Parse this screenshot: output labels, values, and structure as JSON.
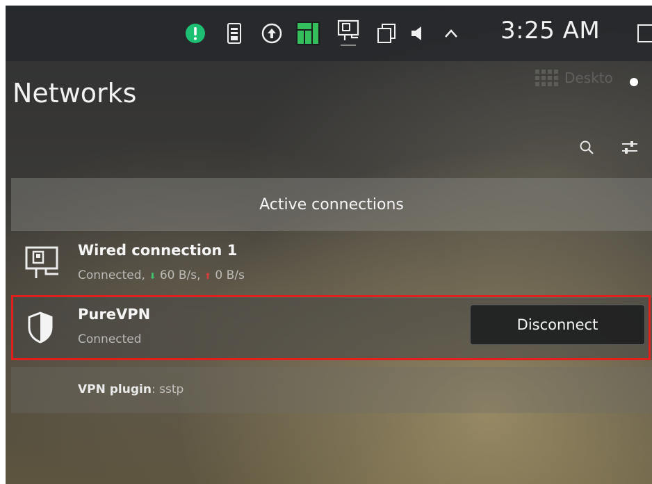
{
  "tray": {
    "clock": "3:25 AM",
    "icons": [
      "update-alert-icon",
      "usb-drive-icon",
      "upload-icon",
      "manjaro-icon",
      "network-icon",
      "clipboard-icon",
      "volume-icon",
      "expand-tray-icon",
      "notification-icon"
    ]
  },
  "colors": {
    "alert_green": "#1dbf73",
    "manjaro_green": "#35bf5c",
    "highlight_red": "#e0201c"
  },
  "header": {
    "title": "Networks",
    "ghost_text": "Deskto"
  },
  "toolbar": {
    "search_icon": "search-icon",
    "settings_icon": "configure-icon"
  },
  "section": {
    "title": "Active connections"
  },
  "connections": {
    "wired": {
      "name": "Wired connection 1",
      "status": "Connected,",
      "download": "60 B/s,",
      "upload": "0 B/s"
    },
    "vpn": {
      "name": "PureVPN",
      "status": "Connected",
      "button": "Disconnect"
    }
  },
  "details": {
    "label": "VPN plugin",
    "value": ": sstp"
  }
}
